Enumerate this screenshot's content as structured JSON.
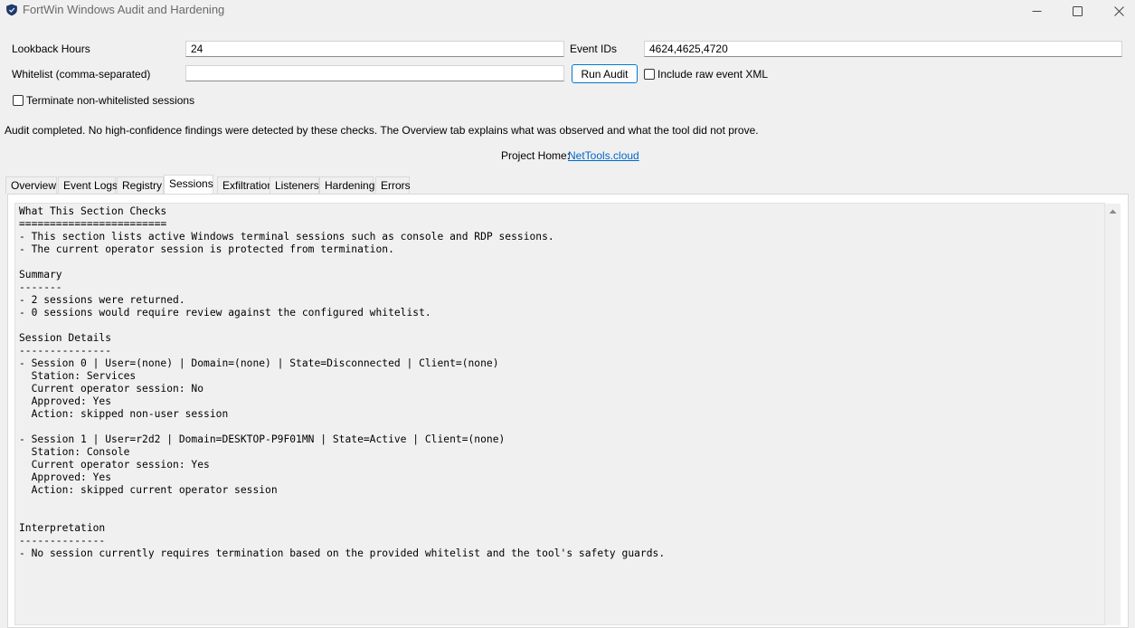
{
  "window": {
    "title": "FortWin Windows Audit and Hardening",
    "icons": {
      "app": "app-shield-icon",
      "minimize": "minimize-icon",
      "maximize": "maximize-icon",
      "close": "close-icon"
    }
  },
  "form": {
    "lookback_label": "Lookback Hours",
    "lookback_value": "24",
    "event_ids_label": "Event IDs",
    "event_ids_value": "4624,4625,4720",
    "whitelist_label": "Whitelist (comma-separated)",
    "whitelist_value": "",
    "run_button": "Run Audit",
    "include_xml_label": "Include raw event XML",
    "include_xml_checked": false,
    "terminate_label": "Terminate non-whitelisted sessions",
    "terminate_checked": false
  },
  "status": {
    "message": "Audit completed. No high-confidence findings were detected by these checks. The Overview tab explains what was observed and what the tool did not prove.",
    "project_home_label": "Project Home:",
    "project_home_link": "NetTools.cloud"
  },
  "tabs": [
    {
      "label": "Overview"
    },
    {
      "label": "Event Logs"
    },
    {
      "label": "Registry"
    },
    {
      "label": "Sessions",
      "active": true
    },
    {
      "label": "Exfiltration"
    },
    {
      "label": "Listeners"
    },
    {
      "label": "Hardening"
    },
    {
      "label": "Errors"
    }
  ],
  "sessions_report": {
    "lines": [
      "What This Section Checks",
      "========================",
      "- This section lists active Windows terminal sessions such as console and RDP sessions.",
      "- The current operator session is protected from termination.",
      "",
      "Summary",
      "-------",
      "- 2 sessions were returned.",
      "- 0 sessions would require review against the configured whitelist.",
      "",
      "Session Details",
      "---------------",
      "- Session 0 | User=(none) | Domain=(none) | State=Disconnected | Client=(none)",
      "  Station: Services",
      "  Current operator session: No",
      "  Approved: Yes",
      "  Action: skipped non-user session",
      "",
      "- Session 1 | User=r2d2 | Domain=DESKTOP-P9F01MN | State=Active | Client=(none)",
      "  Station: Console",
      "  Current operator session: Yes",
      "  Approved: Yes",
      "  Action: skipped current operator session",
      "",
      "",
      "Interpretation",
      "--------------",
      "- No session currently requires termination based on the provided whitelist and the tool's safety guards."
    ]
  },
  "scrollbar": {
    "up_icon": "scroll-up-arrow-icon"
  }
}
